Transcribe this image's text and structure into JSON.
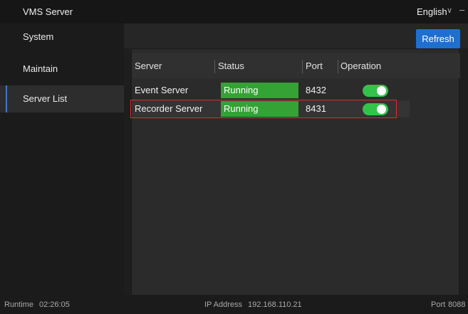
{
  "app": {
    "title": "VMS Server",
    "language": "English"
  },
  "sidebar": {
    "items": [
      {
        "label": "System"
      },
      {
        "label": "Maintain"
      },
      {
        "label": "Server List"
      }
    ]
  },
  "toolbar": {
    "refresh_label": "Refresh"
  },
  "table": {
    "headers": [
      "Server",
      "Status",
      "Port",
      "Operation"
    ],
    "rows": [
      {
        "server": "Event Server",
        "status": "Running",
        "port": "8432",
        "enabled": true
      },
      {
        "server": "Recorder Server",
        "status": "Running",
        "port": "8431",
        "enabled": true
      }
    ]
  },
  "statusbar": {
    "runtime_label": "Runtime",
    "runtime_value": "02:26:05",
    "ip_label": "IP Address",
    "ip_value": "192.168.110.21",
    "port_label": "Port",
    "port_value": "8088"
  },
  "colors": {
    "accent": "#1f6fd0",
    "running": "#34a234",
    "toggle_on": "#33c24a",
    "highlight": "#e02b2b"
  },
  "icons": {
    "language_dropdown": "chevron-down-icon",
    "window_minimize": "minimize-icon"
  }
}
